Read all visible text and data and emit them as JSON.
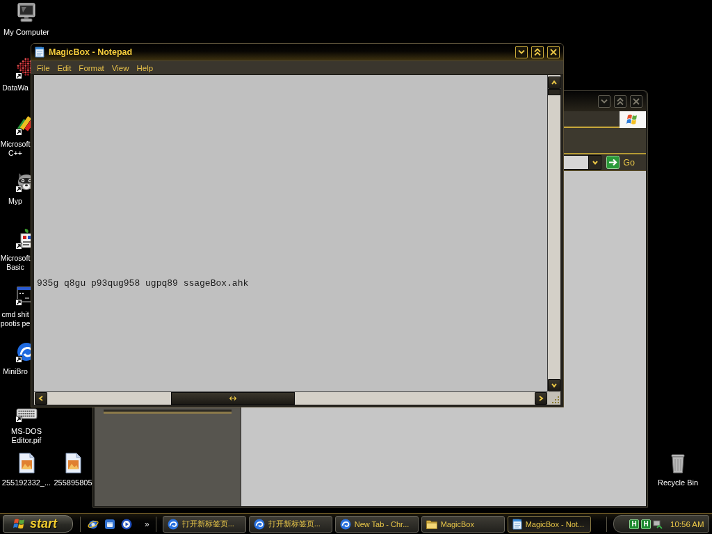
{
  "desktop_icons": [
    {
      "label": "My Computer",
      "kind": "computer",
      "shortcut": false
    },
    {
      "label": "DataWa",
      "kind": "pattern",
      "shortcut": true
    },
    {
      "label": "Microsoft C++",
      "kind": "pencils",
      "shortcut": true
    },
    {
      "label": "Myp",
      "kind": "raccoon",
      "shortcut": true
    },
    {
      "label": "Microsoft Basic",
      "kind": "leaf",
      "shortcut": true
    },
    {
      "label": "cmd shit pootis pe",
      "kind": "console",
      "shortcut": true
    },
    {
      "label": "MiniBro",
      "kind": "swirl",
      "shortcut": true
    },
    {
      "label": "MS-DOS Editor.pif",
      "kind": "keyboard",
      "shortcut": true
    },
    {
      "label": "255192332_...",
      "kind": "image",
      "shortcut": false
    },
    {
      "label": "255895805",
      "kind": "image",
      "shortcut": false
    },
    {
      "label": "Recycle Bin",
      "kind": "bin",
      "shortcut": false
    }
  ],
  "notepad_window": {
    "title": "MagicBox - Notepad",
    "active": true,
    "menu": [
      "File",
      "Edit",
      "Format",
      "View",
      "Help"
    ],
    "text": "935g q8gu p93qug958 ugpq89 ssageBox.ahk"
  },
  "explorer_window": {
    "active": false,
    "go_button": "Go"
  },
  "taskbar": {
    "start_button": "start",
    "quick_launch_more": "»",
    "tasks": [
      {
        "label": "打开新标签页...",
        "kind": "swirl",
        "selected": false
      },
      {
        "label": "打开新标签页...",
        "kind": "swirl",
        "selected": false
      },
      {
        "label": "New Tab - Chr...",
        "kind": "swirl",
        "selected": false
      },
      {
        "label": "MagicBox",
        "kind": "folder",
        "selected": false
      },
      {
        "label": "MagicBox - Not...",
        "kind": "notepad",
        "selected": true
      }
    ],
    "tray_icons": [
      "H",
      "H"
    ],
    "clock": "10:56 AM"
  }
}
